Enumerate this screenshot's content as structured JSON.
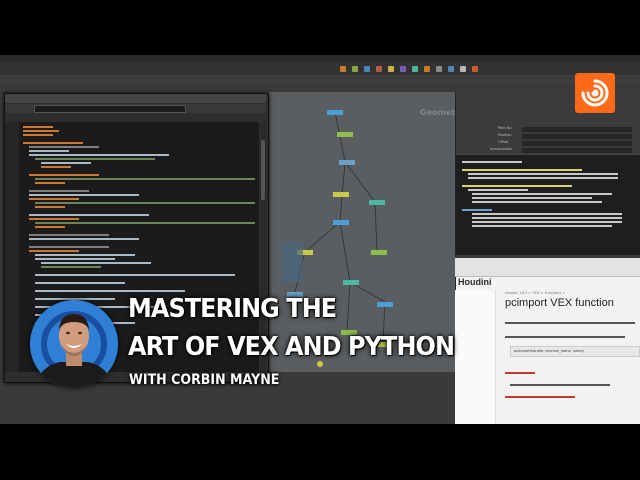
{
  "thumbnail": {
    "title_line1": "MASTERING THE",
    "title_line2": "ART OF VEX AND PYTHON",
    "subtitle": "WITH CORBIN MAYNE"
  },
  "houdini": {
    "help_logo": "Houdini",
    "help_page_title": "pcimport VEX function",
    "help_breadcrumb": "Houdini 18.5 > VEX > Functions >",
    "help_code": "pcimport(handle, channel_name, value)",
    "netview_label": "Geometry",
    "param_labels": [
      "Path No.",
      "Position",
      "Offset",
      "Interpolation"
    ]
  },
  "colors": {
    "accent_orange": "#ff6a1a",
    "avatar_blue": "#2f7fd6",
    "network_bg": "#5a5e61",
    "code_bg": "#1b1b1b"
  },
  "icons": [
    "houdini-logo-icon",
    "python-code-icon",
    "node-icon"
  ]
}
